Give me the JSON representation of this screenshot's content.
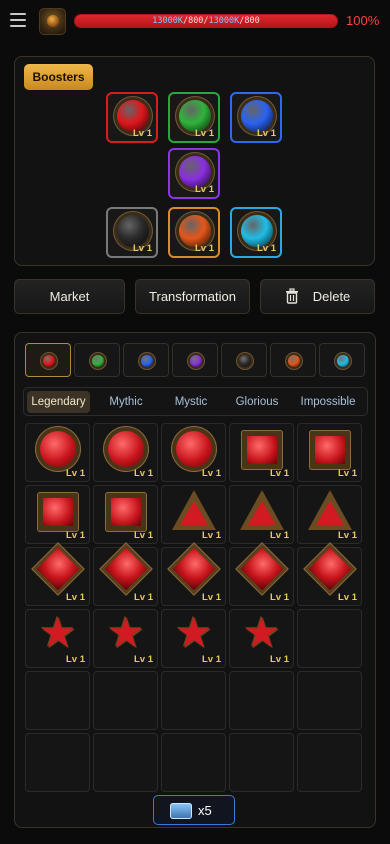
{
  "header": {
    "hp_text_cur_part1": "13000K",
    "hp_text_sep1": "/800/",
    "hp_text_cur_part2": "13000K",
    "hp_text_sep2": "/800",
    "hp_percent_label": "100%",
    "hp_fraction": 1.0,
    "menu_icon": "hamburger-icon",
    "avatar_icon": "helmet-icon"
  },
  "boosters": {
    "label": "Boosters",
    "slots": [
      {
        "color": "#e0161c",
        "frame": "#d91c1c",
        "level": "Lv 1"
      },
      {
        "color": "#2fb43a",
        "frame": "#27a83a",
        "level": "Lv 1"
      },
      {
        "color": "#2a63f0",
        "frame": "#2f68f2",
        "level": "Lv 1"
      },
      {
        "color": "#8a2ee0",
        "frame": "#8a35e6",
        "level": "Lv 1"
      },
      {
        "color": "#2a2a2a",
        "frame": "#7a7a7a",
        "level": "Lv 1"
      },
      {
        "color": "#e6561a",
        "frame": "#d98c2a",
        "level": "Lv 1"
      },
      {
        "color": "#1fbde6",
        "frame": "#2aa8e0",
        "level": "Lv 1"
      }
    ]
  },
  "actions": {
    "market": "Market",
    "transformation": "Transformation",
    "delete": "Delete"
  },
  "inventory": {
    "gem_tabs": [
      {
        "color": "#e0161c"
      },
      {
        "color": "#2fb43a"
      },
      {
        "color": "#2a63f0"
      },
      {
        "color": "#8a2ee0"
      },
      {
        "color": "#2a2a2a"
      },
      {
        "color": "#e6561a"
      },
      {
        "color": "#1fbde6"
      }
    ],
    "rarity_tabs": [
      "Legendary",
      "Mythic",
      "Mystic",
      "Glorious",
      "Impossible"
    ],
    "active_rarity": "Legendary",
    "cells": [
      {
        "shape": "orb",
        "level": "Lv 1"
      },
      {
        "shape": "orb",
        "level": "Lv 1"
      },
      {
        "shape": "orb",
        "level": "Lv 1"
      },
      {
        "shape": "square",
        "level": "Lv 1"
      },
      {
        "shape": "square",
        "level": "Lv 1"
      },
      {
        "shape": "square",
        "level": "Lv 1"
      },
      {
        "shape": "square",
        "level": "Lv 1"
      },
      {
        "shape": "triangle",
        "level": "Lv 1"
      },
      {
        "shape": "triangle",
        "level": "Lv 1"
      },
      {
        "shape": "triangle",
        "level": "Lv 1"
      },
      {
        "shape": "diamond",
        "level": "Lv 1"
      },
      {
        "shape": "diamond",
        "level": "Lv 1"
      },
      {
        "shape": "diamond",
        "level": "Lv 1"
      },
      {
        "shape": "diamond",
        "level": "Lv 1"
      },
      {
        "shape": "diamond",
        "level": "Lv 1"
      },
      {
        "shape": "star",
        "level": "Lv 1"
      },
      {
        "shape": "star",
        "level": "Lv 1"
      },
      {
        "shape": "star",
        "level": "Lv 1"
      },
      {
        "shape": "star",
        "level": "Lv 1"
      },
      {
        "shape": "empty",
        "level": ""
      },
      {
        "shape": "empty",
        "level": ""
      },
      {
        "shape": "empty",
        "level": ""
      },
      {
        "shape": "empty",
        "level": ""
      },
      {
        "shape": "empty",
        "level": ""
      },
      {
        "shape": "empty",
        "level": ""
      },
      {
        "shape": "empty",
        "level": ""
      },
      {
        "shape": "empty",
        "level": ""
      },
      {
        "shape": "empty",
        "level": ""
      },
      {
        "shape": "empty",
        "level": ""
      },
      {
        "shape": "empty",
        "level": ""
      }
    ]
  },
  "chest": {
    "icon": "chest-icon",
    "count_label": "x5"
  }
}
